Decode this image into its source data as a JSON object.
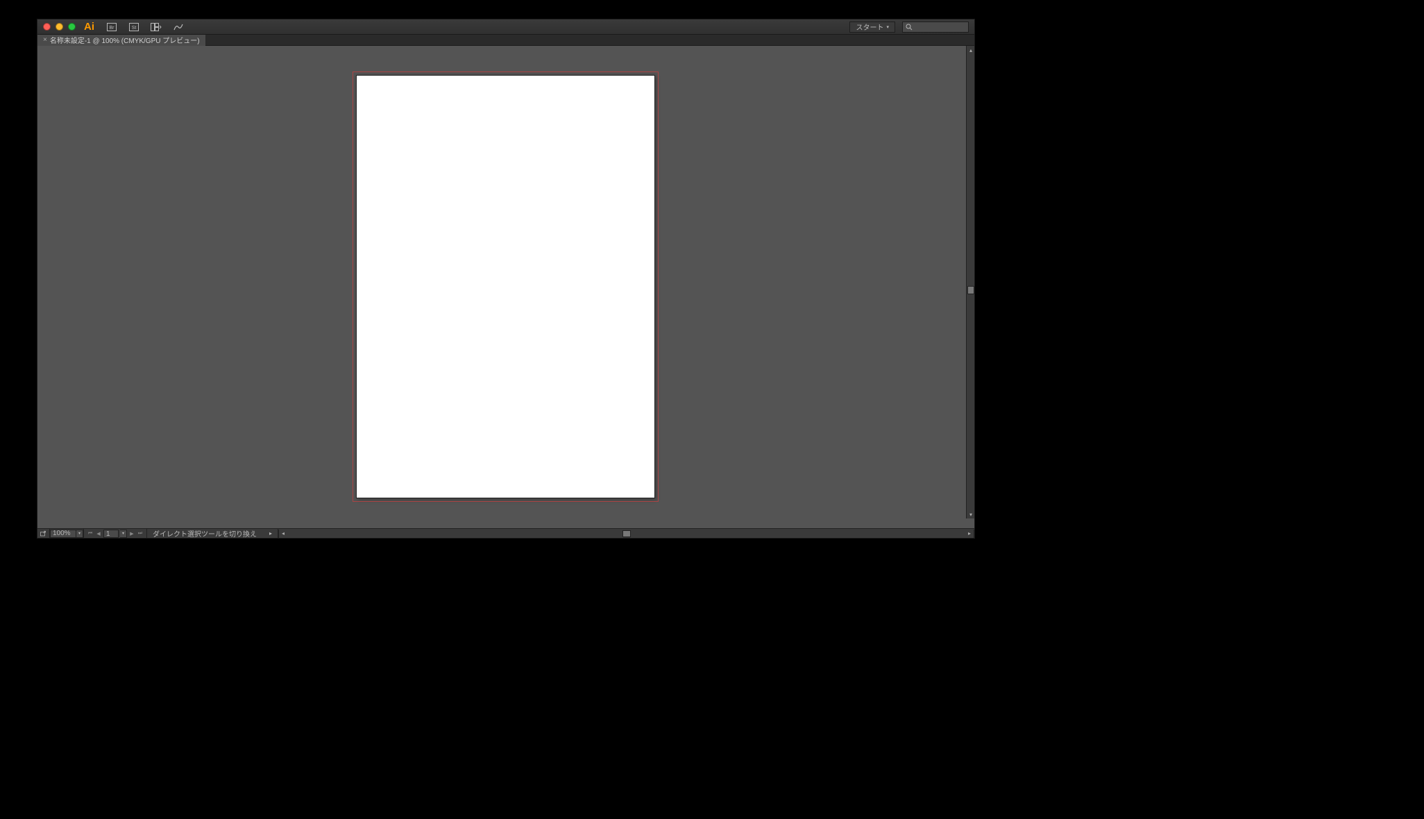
{
  "app_logo": "Ai",
  "titlebar": {
    "start_label": "スタート"
  },
  "tab": {
    "title": "名称未設定-1 @ 100% (CMYK/GPU プレビュー)"
  },
  "status": {
    "zoom": "100%",
    "artboard_number": "1",
    "tool_hint": "ダイレクト選択ツールを切り換え"
  }
}
